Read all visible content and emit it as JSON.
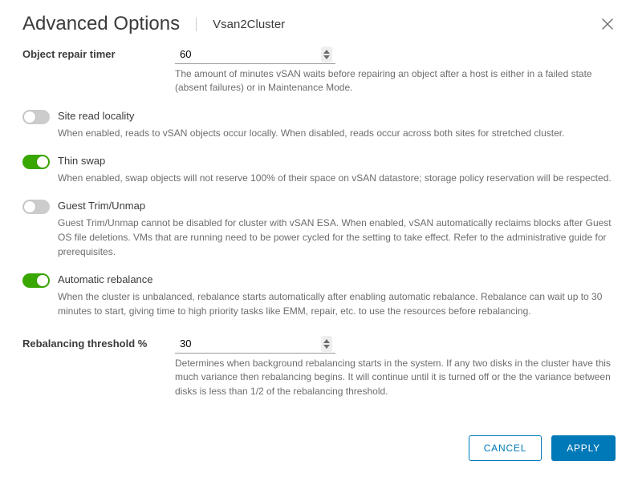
{
  "header": {
    "title": "Advanced Options",
    "context": "Vsan2Cluster"
  },
  "fields": {
    "objectRepairTimer": {
      "label": "Object repair timer",
      "value": "60",
      "help": "The amount of minutes vSAN waits before repairing an object after a host is either in a failed state (absent failures) or in Maintenance Mode."
    },
    "siteReadLocality": {
      "label": "Site read locality",
      "help": "When enabled, reads to vSAN objects occur locally. When disabled, reads occur across both sites for stretched cluster.",
      "on": false
    },
    "thinSwap": {
      "label": "Thin swap",
      "help": "When enabled, swap objects will not reserve 100% of their space on vSAN datastore; storage policy reservation will be respected.",
      "on": true
    },
    "guestTrim": {
      "label": "Guest Trim/Unmap",
      "help": "Guest Trim/Unmap cannot be disabled for cluster with vSAN ESA. When enabled, vSAN automatically reclaims blocks after Guest OS file deletions. VMs that are running need to be power cycled for the setting to take effect. Refer to the administrative guide for prerequisites.",
      "on": false
    },
    "automaticRebalance": {
      "label": "Automatic rebalance",
      "help": "When the cluster is unbalanced, rebalance starts automatically after enabling automatic rebalance. Rebalance can wait up to 30 minutes to start, giving time to high priority tasks like EMM, repair, etc. to use the resources before rebalancing.",
      "on": true
    },
    "rebalancingThreshold": {
      "label": "Rebalancing threshold %",
      "value": "30",
      "help": "Determines when background rebalancing starts in the system. If any two disks in the cluster have this much variance then rebalancing begins. It will continue until it is turned off or the the variance between disks is less than 1/2 of the rebalancing threshold."
    }
  },
  "footer": {
    "cancel": "CANCEL",
    "apply": "APPLY"
  }
}
